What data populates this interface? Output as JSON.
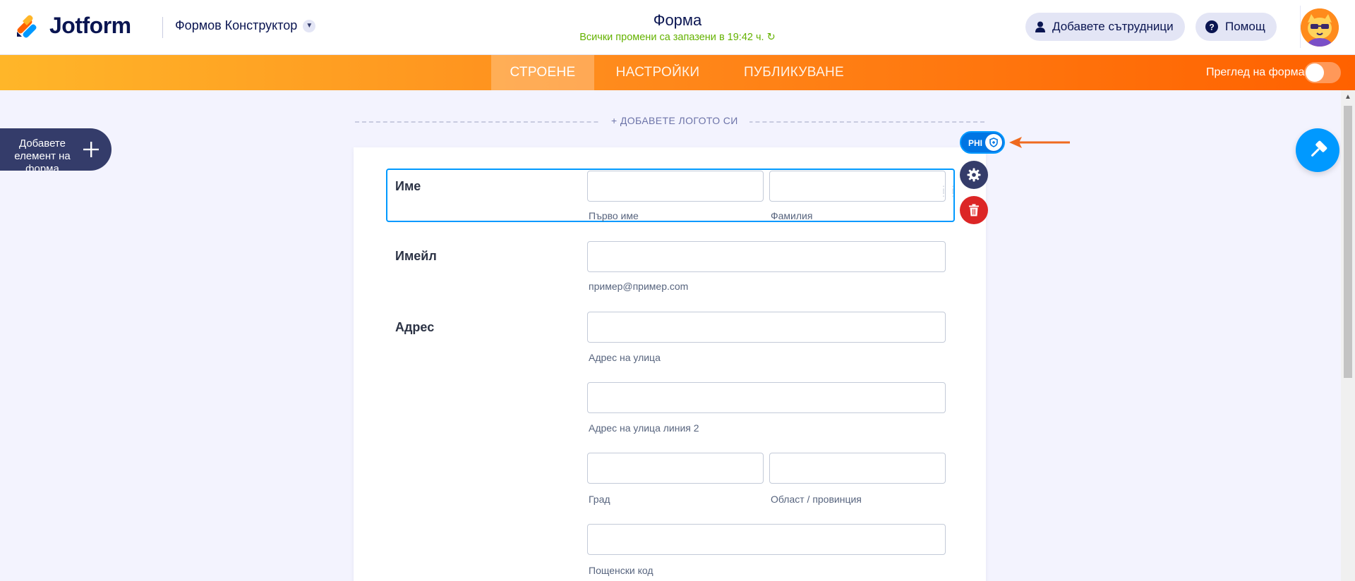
{
  "header": {
    "brand": "Jotform",
    "builder_menu": "Формов Конструктор",
    "form_title": "Форма",
    "save_status": "Всички промени са запазени в 19:42 ч. ↻",
    "add_collaborators": "Добавете сътрудници",
    "help": "Помощ"
  },
  "nav": {
    "tabs": [
      {
        "label": "СТРОЕНЕ",
        "active": true
      },
      {
        "label": "НАСТРОЙКИ",
        "active": false
      },
      {
        "label": "ПУБЛИКУВАНЕ",
        "active": false
      }
    ],
    "preview_label": "Преглед на форма",
    "preview_enabled": false
  },
  "sidebar": {
    "add_element": "Добавете елемент на форма"
  },
  "form": {
    "add_logo": "+ ДОБАВЕТЕ ЛОГОТО СИ",
    "fields": {
      "name": {
        "label": "Име",
        "first_sublabel": "Първо име",
        "last_sublabel": "Фамилия"
      },
      "email": {
        "label": "Имейл",
        "sublabel": "пример@пример.com"
      },
      "address": {
        "label": "Адрес",
        "street": "Адрес на улица",
        "street2": "Адрес на улица линия 2",
        "city": "Град",
        "region": "Област / провинция",
        "postal": "Пощенски код"
      }
    }
  },
  "field_tools": {
    "phi_label": "PHI"
  },
  "colors": {
    "accent_orange": "#ff6100",
    "selection_blue": "#0099ff",
    "save_green": "#64b200",
    "delete_red": "#dc2626",
    "navy": "#0a1551"
  },
  "icons": [
    "jotform-logo-icon",
    "chevron-down-icon",
    "user-icon",
    "help-circle-icon",
    "avatar-icon",
    "plus-icon",
    "paint-roller-icon",
    "gear-icon",
    "trash-icon",
    "shield-icon",
    "arrow-left-icon"
  ]
}
